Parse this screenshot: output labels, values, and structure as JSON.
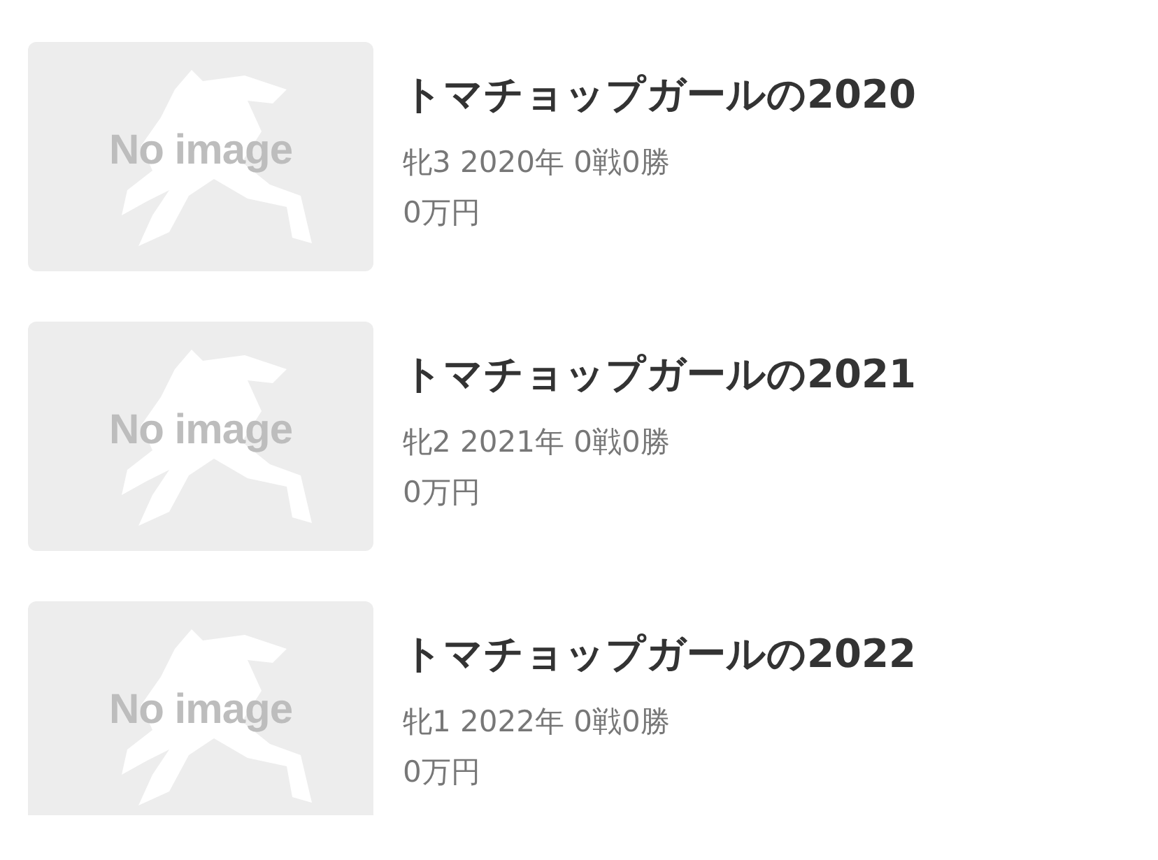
{
  "horses": [
    {
      "placeholder": "No image",
      "name": "トマチョップガールの2020",
      "profile": "牝3 2020年 0戦0勝",
      "earnings": "0万円"
    },
    {
      "placeholder": "No image",
      "name": "トマチョップガールの2021",
      "profile": "牝2 2021年 0戦0勝",
      "earnings": "0万円"
    },
    {
      "placeholder": "No image",
      "name": "トマチョップガールの2022",
      "profile": "牝1 2022年 0戦0勝",
      "earnings": "0万円"
    }
  ]
}
